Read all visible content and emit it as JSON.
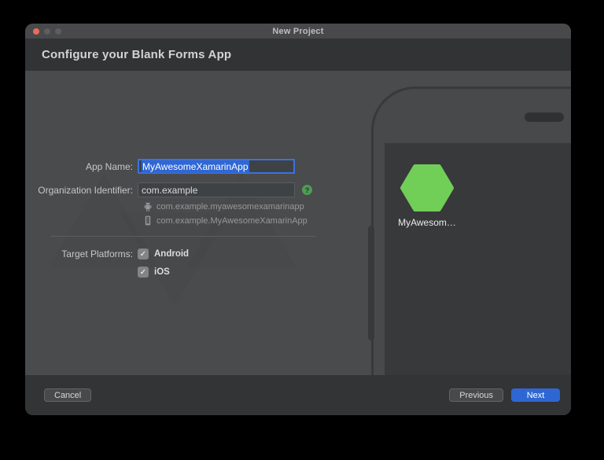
{
  "window": {
    "title": "New Project"
  },
  "header": {
    "title": "Configure your Blank Forms App"
  },
  "form": {
    "app_name": {
      "label": "App Name:",
      "value": "MyAwesomeXamarinApp",
      "selected": true
    },
    "org_identifier": {
      "label": "Organization Identifier:",
      "value": "com.example"
    },
    "android_package": "com.example.myawesomexamarinapp",
    "ios_bundle": "com.example.MyAwesomeXamarinApp",
    "target_platforms": {
      "label": "Target Platforms:",
      "options": [
        {
          "label": "Android",
          "checked": true
        },
        {
          "label": "iOS",
          "checked": true
        }
      ]
    }
  },
  "preview": {
    "app_label": "MyAwesom…"
  },
  "footer": {
    "cancel_label": "Cancel",
    "previous_label": "Previous",
    "next_label": "Next"
  },
  "icons": {
    "help": "?",
    "checkmark": "✓"
  },
  "colors": {
    "accent_blue": "#2e67d3",
    "selection_blue": "#2f67d4",
    "focus_border": "#3b72de",
    "hexagon_green": "#71ce57",
    "help_green": "#4d9d53",
    "traffic_red": "#ec6a5e",
    "window_bg": "#4a4b4d",
    "band_bg": "#323335"
  }
}
